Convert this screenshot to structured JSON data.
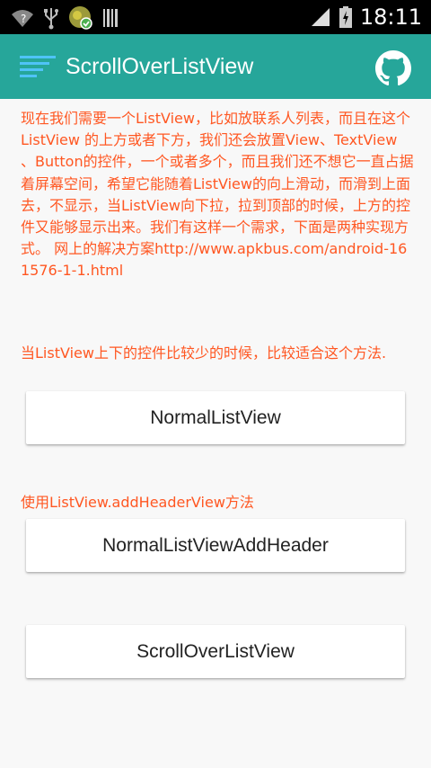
{
  "status_bar": {
    "time": "18:11",
    "icons": [
      "wifi-question-icon",
      "usb-icon",
      "app-notification-icon",
      "barcode-icon",
      "signal-icon",
      "battery-icon"
    ]
  },
  "app_bar": {
    "title": "ScrollOverListView",
    "menu_icon": "menu-icon",
    "action_icon": "github-icon",
    "background": "#26a69a"
  },
  "content": {
    "description": "现在我们需要一个ListView，比如放联系人列表，而且在这个ListView 的上方或者下方，我们还会放置View、TextView 、Button的控件，一个或者多个，而且我们还不想它一直占据着屏幕空间，希望它能随着ListView的向上滑动，而滑到上面去，不显示，当ListView向下拉，拉到顶部的时候，上方的控件又能够显示出来。我们有这样一个需求，下面是两种实现方式。 网上的解决方案http://www.apkbus.com/android-161576-1-1.html",
    "hint_normal": "当ListView上下的控件比较少的时候，比较适合这个方法.",
    "button_normal": "NormalListView",
    "hint_header": "使用ListView.addHeaderView方法",
    "button_header": "NormalListViewAddHeader",
    "button_scroll": "ScrollOverListView"
  },
  "colors": {
    "accent_text": "#ff5722",
    "status_bar": "#000000",
    "page_background": "#f8f8f8"
  }
}
